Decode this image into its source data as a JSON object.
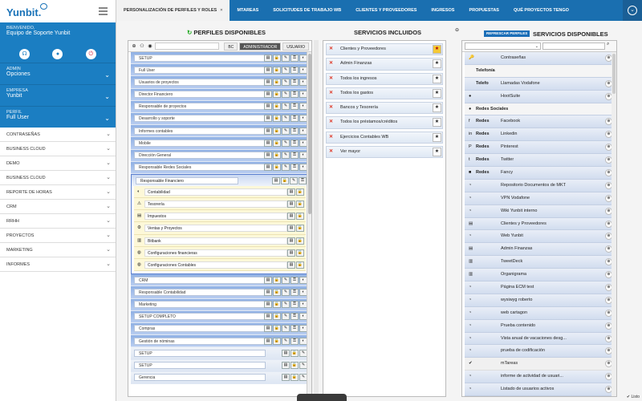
{
  "app": {
    "logo": "Yunbit."
  },
  "sidebar": {
    "welcome_label": "BIENVENIDO,",
    "welcome_value": "Equipo de Soporte Yunbit",
    "sections": [
      {
        "label": "ADMIN",
        "value": "Opciones"
      },
      {
        "label": "EMPRESA",
        "value": "Yunbit"
      },
      {
        "label": "PERFIL",
        "value": "Full User"
      }
    ],
    "menu": [
      "CONTRASEÑAS",
      "BUSINESS CLOUD",
      "DEMO",
      "BUSINESS CLOUD",
      "REPORTE DE HORAS",
      "CRM",
      "RRHH",
      "PROYECTOS",
      "MARKETING",
      "INFORMES"
    ]
  },
  "tabs": [
    {
      "label": "PERSONALIZACIÓN DE PERFILES Y ROLES",
      "close": "×"
    },
    {
      "label": "MTAREAS"
    },
    {
      "label": "SOLICITUDES DE TRABAJO WB"
    },
    {
      "label": "CLIENTES Y PROVEEDORES"
    },
    {
      "label": "INGRESOS"
    },
    {
      "label": "PROPUESTAS"
    },
    {
      "label": "QUÉ PROYECTOS TENGO"
    }
  ],
  "perfiles": {
    "title": "PERFILES DISPONIBLES",
    "filters": [
      "BC",
      "ADMINISTRADOR",
      "USUARIO"
    ],
    "rows_before": [
      "SETUP",
      "Full User",
      "Usuarios de proyectos",
      "Director Financiero",
      "Responsable de proyectos",
      "Desarrollo y soporte",
      "Informes contables",
      "Mobile",
      "Dirección General",
      "Responsable Redes Sociales"
    ],
    "expanded": {
      "label": "Responsable Financiero",
      "items": [
        "Contabilidad",
        "Tesorería",
        "Impuestos",
        "Ventas y Proyectos",
        "Bitbank",
        "Configuraciones financieras",
        "Configuraciones Contables"
      ],
      "icons": [
        "◐",
        "⚠",
        "▤",
        "⚙",
        "▥",
        "◍",
        "◍"
      ]
    },
    "rows_after": [
      "CRM",
      "Responsable Contabilidad",
      "Marketing",
      "SETUP COMPLETO",
      "Compras",
      "Gestión de nóminas"
    ],
    "rows_white": [
      "SETUP",
      "SETUP",
      "Gerencia"
    ]
  },
  "incluidos": {
    "title": "SERVICIOS INCLUIDOS",
    "items": [
      "Clientes y Proveedores",
      "Admin Finanzas",
      "Todos los ingresos",
      "Todos los gastos",
      "Bancos y Tesorería",
      "Todos los préstamos/créditos",
      "Ejercicios Contables WB",
      "Ver mayor"
    ]
  },
  "disponibles": {
    "title": "SERVICIOS DISPONIBLES",
    "refresh": "REFRESCAR PERFILES",
    "rows": [
      {
        "tag": "",
        "t": "Contraseñas",
        "ico": "🔑",
        "k": "n"
      },
      {
        "tag": "Telefonía",
        "t": "",
        "ico": "",
        "k": "hdr"
      },
      {
        "tag": "Telefo",
        "t": "Llamadas Vodafone",
        "ico": "",
        "k": "n"
      },
      {
        "tag": "",
        "t": "HootSuite",
        "ico": "●",
        "k": "n"
      },
      {
        "tag": "Redes Sociales",
        "t": "",
        "ico": "●",
        "k": "hdr"
      },
      {
        "tag": "Redes",
        "t": "Facebook",
        "ico": "f",
        "k": "n"
      },
      {
        "tag": "Redes",
        "t": "Linkedin",
        "ico": "in",
        "k": "n"
      },
      {
        "tag": "Redes",
        "t": "Pinterest",
        "ico": "P",
        "k": "n"
      },
      {
        "tag": "Redes",
        "t": "Twitter",
        "ico": "t",
        "k": "n"
      },
      {
        "tag": "Redes",
        "t": "Fancy",
        "ico": "■",
        "k": "n"
      },
      {
        "tag": "",
        "t": "Repositorio Documentos de MKT",
        "ico": "◔",
        "k": "n"
      },
      {
        "tag": "",
        "t": "VPN Vodafone",
        "ico": "◔",
        "k": "n"
      },
      {
        "tag": "",
        "t": "Wiki Yunbit interno",
        "ico": "◔",
        "k": "n"
      },
      {
        "tag": "",
        "t": "Clientes y Proveedores",
        "ico": "▤",
        "k": "n"
      },
      {
        "tag": "",
        "t": "Web Yunbit",
        "ico": "◔",
        "k": "n"
      },
      {
        "tag": "",
        "t": "Admin Finanzas",
        "ico": "▤",
        "k": "n"
      },
      {
        "tag": "",
        "t": "TweetDeck",
        "ico": "▥",
        "k": "n"
      },
      {
        "tag": "",
        "t": "Organigrama",
        "ico": "▥",
        "k": "n"
      },
      {
        "tag": "",
        "t": "Página ECM test",
        "ico": "◔",
        "k": "n"
      },
      {
        "tag": "",
        "t": "wysiwyg roberto",
        "ico": "◔",
        "k": "n"
      },
      {
        "tag": "",
        "t": "web cartagon",
        "ico": "◔",
        "k": "n"
      },
      {
        "tag": "",
        "t": "Prueba contenido",
        "ico": "◔",
        "k": "n"
      },
      {
        "tag": "",
        "t": "Vista anual de vacaciones desg...",
        "ico": "◔",
        "k": "n"
      },
      {
        "tag": "",
        "t": "prueba de codificación",
        "ico": "◔",
        "k": "n"
      },
      {
        "tag": "",
        "t": "mTareas",
        "ico": "✔",
        "k": "g"
      },
      {
        "tag": "",
        "t": "informe de actividad de usuari...",
        "ico": "◔",
        "k": "n"
      },
      {
        "tag": "",
        "t": "Listado de usuarios activos",
        "ico": "◔",
        "k": "n"
      }
    ]
  },
  "status": "Listo"
}
